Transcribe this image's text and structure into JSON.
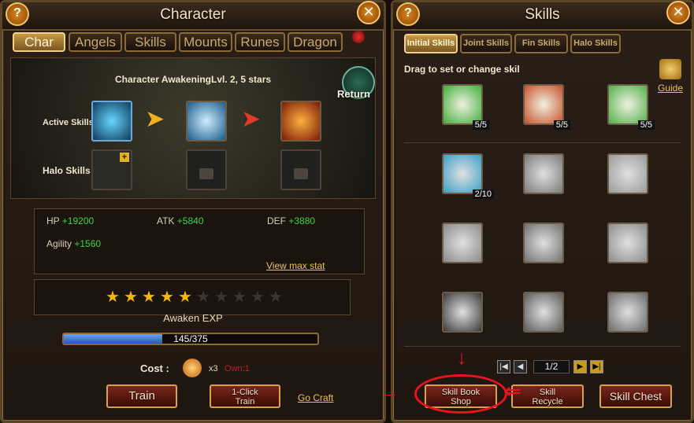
{
  "left_panel": {
    "title": "Character",
    "tabs": [
      {
        "label": "Char",
        "active": true
      },
      {
        "label": "Angels"
      },
      {
        "label": "Skills"
      },
      {
        "label": "Mounts"
      },
      {
        "label": "Runes"
      },
      {
        "label": "Dragon"
      }
    ],
    "awakening_title": "Character AwakeningLvl. 2, 5 stars",
    "return_label": "Return",
    "active_skills_label": "Active Skills",
    "halo_skills_label": "Halo Skills",
    "stats": {
      "hp_label": "HP",
      "hp_value": "+19200",
      "atk_label": "ATK",
      "atk_value": "+5840",
      "def_label": "DEF",
      "def_value": "+3880",
      "agility_label": "Agility",
      "agility_value": "+1560"
    },
    "view_max_stat": "View max stat",
    "stars": {
      "filled": 5,
      "total": 10
    },
    "awaken_exp_label": "Awaken EXP",
    "exp_progress_text": "145/375",
    "exp_fraction": 0.387,
    "cost_label": "Cost :",
    "cost_qty": "x3",
    "cost_owned": "Own:1",
    "train_label": "Train",
    "one_click_train_label": "1-Click\nTrain",
    "go_craft_label": "Go Craft",
    "help_glyph": "?",
    "close_glyph": "✕"
  },
  "right_panel": {
    "title": "Skills",
    "tabs": [
      {
        "label": "Initial Skills",
        "active": true
      },
      {
        "label": "Joint Skills"
      },
      {
        "label": "Fin Skills"
      },
      {
        "label": "Halo Skills"
      }
    ],
    "drag_hint": "Drag to set or change skil",
    "guide_label": "Guide",
    "equipped": [
      {
        "count": "5/5",
        "color": "#3fae3a"
      },
      {
        "count": "5/5",
        "color": "#c8502a"
      },
      {
        "count": "5/5",
        "color": "#4fb04a"
      }
    ],
    "skills_rows": [
      [
        {
          "count": "2/10",
          "color": "#3a9fc8"
        },
        {
          "count": "",
          "color": "#7a7a7a"
        },
        {
          "count": "",
          "color": "#9a9a9a"
        }
      ],
      [
        {
          "count": "",
          "color": "#8a8a8a"
        },
        {
          "count": "",
          "color": "#707070"
        },
        {
          "count": "",
          "color": "#8c8c8c"
        }
      ],
      [
        {
          "count": "",
          "color": "#3a3a3a"
        },
        {
          "count": "",
          "color": "#5a5a5a"
        },
        {
          "count": "",
          "color": "#6a6a6a"
        }
      ]
    ],
    "page_indicator": "1/2",
    "skill_book_shop_label": "Skill Book\nShop",
    "skill_recycle_label": "Skill\nRecycle",
    "skill_chest_label": "Skill Chest",
    "help_glyph": "?",
    "close_glyph": "✕"
  },
  "colors": {
    "accent_gold": "#d6a34c",
    "stat_plus": "#3dd43a",
    "annotation_red": "#e8141c",
    "exp_bar": "#3f7ad8"
  }
}
